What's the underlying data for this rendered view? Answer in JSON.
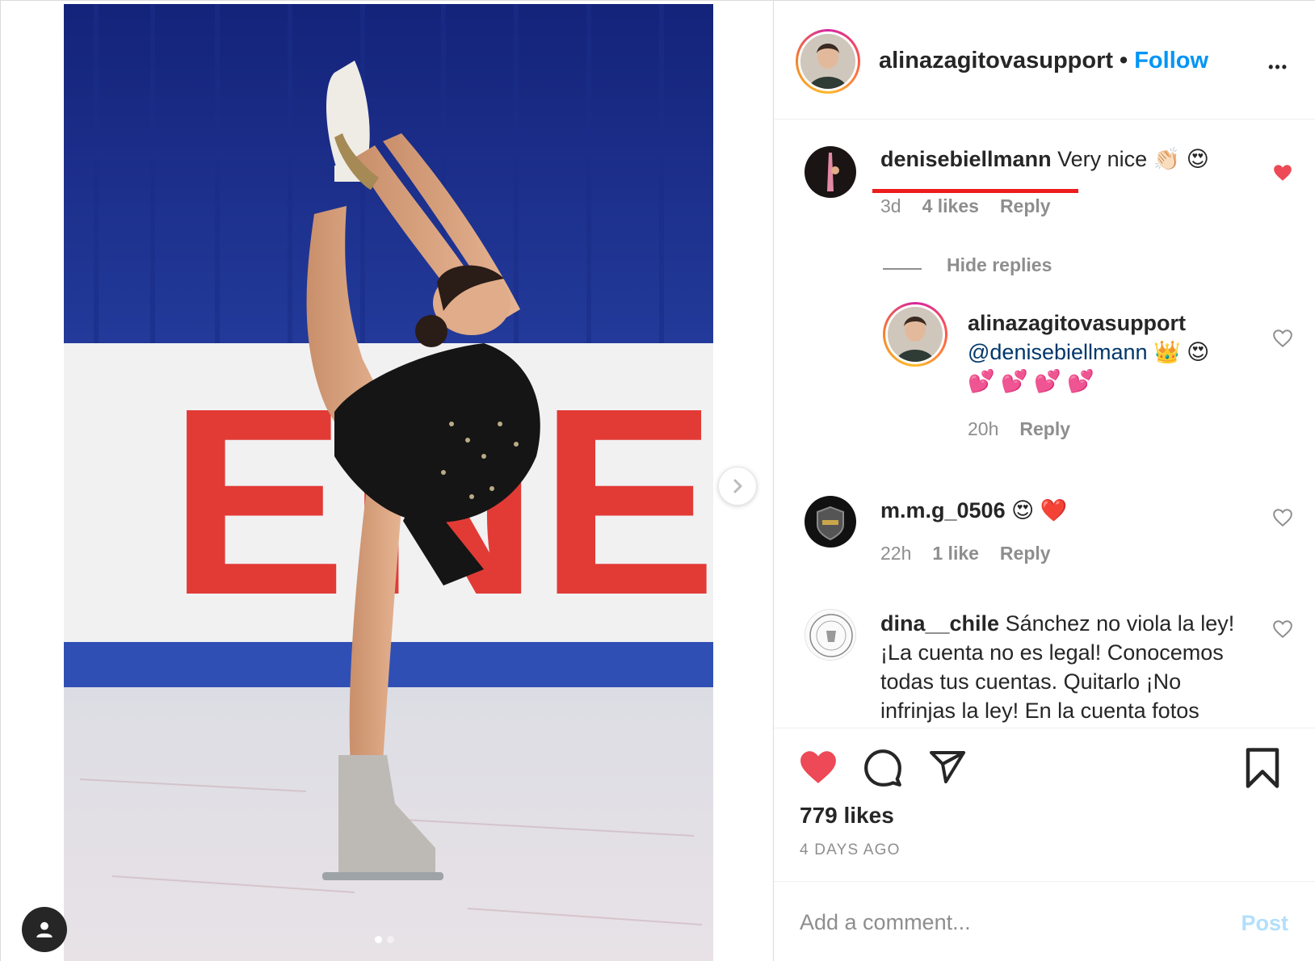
{
  "post": {
    "username": "alinazagitovasupport",
    "follow_label": "Follow",
    "bullet": "•",
    "more_label": "•••",
    "likes": "779 likes",
    "age": "4 DAYS AGO"
  },
  "comments": [
    {
      "username": "denisebiellmann",
      "text": "Very nice 👏🏻 😍",
      "time": "3d",
      "likes": "4 likes",
      "reply_label": "Reply",
      "liked": true
    },
    {
      "username": "alinazagitovasupport",
      "mention": "@denisebiellmann",
      "text": "👑 😍",
      "text2": "💕 💕 💕 💕",
      "time": "20h",
      "reply_label": "Reply",
      "liked": false
    },
    {
      "username": "m.m.g_0506",
      "text": "😍 ❤️",
      "time": "22h",
      "likes": "1 like",
      "reply_label": "Reply",
      "liked": false
    },
    {
      "username": "dina__chile",
      "text": "Sánchez no viola la ley!",
      "line2": "¡La cuenta no es legal! Conocemos",
      "line3": "todas tus cuentas. Quitarlo ¡No",
      "line4": "infrinjas la ley! En la cuenta fotos",
      "liked": false
    }
  ],
  "thread": {
    "hide_replies": "Hide replies"
  },
  "comment_box": {
    "placeholder": "Add a comment...",
    "post_label": "Post"
  },
  "photo": {
    "banner_text": "ENE"
  },
  "colors": {
    "accent": "#0095f6",
    "like_red": "#ed4956",
    "underline_red": "#ee1c1c"
  },
  "icons": [
    "chevron-right-icon",
    "user-icon",
    "heart-icon",
    "comment-icon",
    "share-icon",
    "bookmark-icon",
    "more-icon"
  ]
}
